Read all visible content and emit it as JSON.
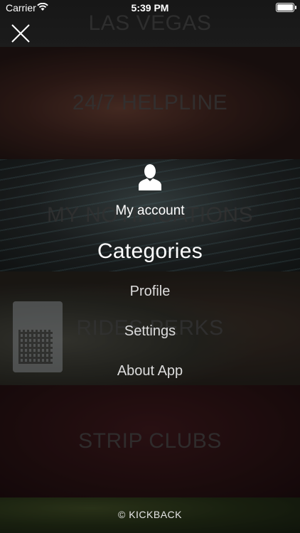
{
  "status_bar": {
    "carrier": "Carrier",
    "time": "5:39 PM"
  },
  "background_bands": [
    {
      "label": "LAS VEGAS"
    },
    {
      "label": "24/7 HELPLINE"
    },
    {
      "label": "MY NOTIFICATIONS"
    },
    {
      "label": "RIDES PERKS"
    },
    {
      "label": "STRIP CLUBS"
    }
  ],
  "menu": {
    "account_label": "My account",
    "title": "Categories",
    "items": [
      {
        "label": "Profile"
      },
      {
        "label": "Settings"
      },
      {
        "label": "About App"
      }
    ]
  },
  "footer": {
    "text": "© KICKBACK"
  },
  "icons": {
    "close": "close-icon",
    "account": "user-icon",
    "wifi": "wifi-icon",
    "battery": "battery-icon"
  },
  "colors": {
    "text": "#ffffff",
    "overlay": "rgba(0,0,0,0.45)"
  }
}
